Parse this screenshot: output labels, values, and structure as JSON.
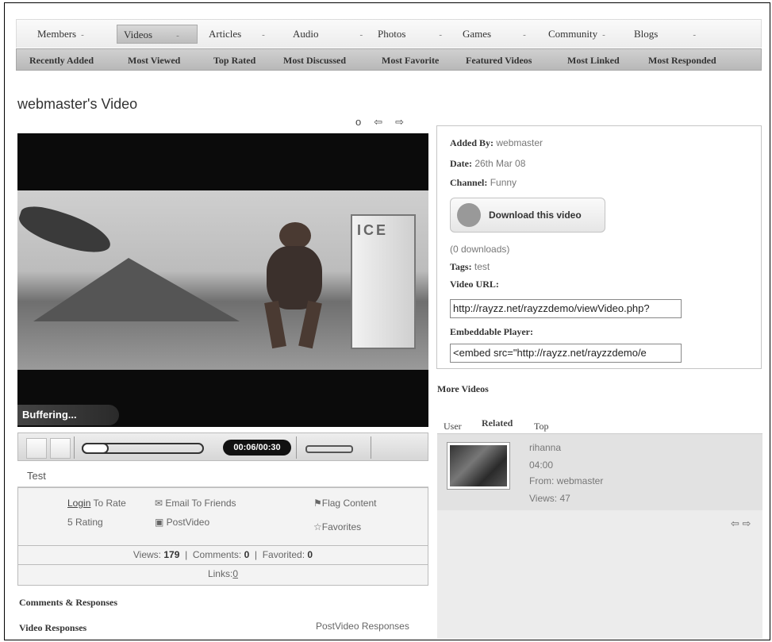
{
  "nav": {
    "tabs": [
      {
        "label": "Members",
        "active": false
      },
      {
        "label": "Videos",
        "active": true
      },
      {
        "label": "Articles",
        "active": false
      },
      {
        "label": "Audio",
        "active": false
      },
      {
        "label": "Photos",
        "active": false
      },
      {
        "label": "Games",
        "active": false
      },
      {
        "label": "Community",
        "active": false
      },
      {
        "label": "Blogs",
        "active": false
      }
    ],
    "dropdown_glyph": "-",
    "sub": [
      "Recently Added",
      "Most Viewed",
      "Top Rated",
      "Most Discussed",
      "Most Favorite",
      "Featured Videos",
      "Most Linked",
      "Most Responded"
    ]
  },
  "page": {
    "title": "webmaster's Video",
    "nav_icons": {
      "refresh": "o",
      "prev": "⇦",
      "next": "⇨"
    }
  },
  "player": {
    "buffering_label": "Buffering...",
    "time": "00:06/00:30",
    "progress": 0.2
  },
  "video": {
    "title": "Test",
    "login_link": "Login",
    "to_rate": "To Rate",
    "rating": "5 Rating",
    "email_friends": "Email To Friends",
    "post_video": "PostVideo",
    "flag": "Flag Content",
    "favorites": "Favorites",
    "views_label": "Views:",
    "views": "179",
    "comments_label": "Comments:",
    "comments": "0",
    "favorited_label": "Favorited:",
    "favorited": "0",
    "links_label": "Links:",
    "links": "0"
  },
  "sections": {
    "comments": "Comments & Responses",
    "responses": "Video Responses",
    "post_responses": "PostVideo Responses"
  },
  "details": {
    "added_by_label": "Added By:",
    "added_by": "webmaster",
    "date_label": "Date:",
    "date": "26th Mar 08",
    "channel_label": "Channel:",
    "channel": "Funny",
    "download_label": "Download this video",
    "downloads": "(0 downloads)",
    "tags_label": "Tags:",
    "tags": "test",
    "video_url_label": "Video URL:",
    "video_url": "http://rayzz.net/rayzzdemo/viewVideo.php?",
    "embed_label": "Embeddable Player:",
    "embed": "<embed src=\"http://rayzz.net/rayzzdemo/e"
  },
  "more_videos": {
    "heading": "More Videos",
    "tabs": [
      "User",
      "Related",
      "Top"
    ],
    "active_tab": "Related",
    "items": [
      {
        "title": "rihanna",
        "duration": "04:00",
        "from": "From: webmaster",
        "views": "Views: 47"
      }
    ],
    "arrows": "⇦ ⇨"
  }
}
